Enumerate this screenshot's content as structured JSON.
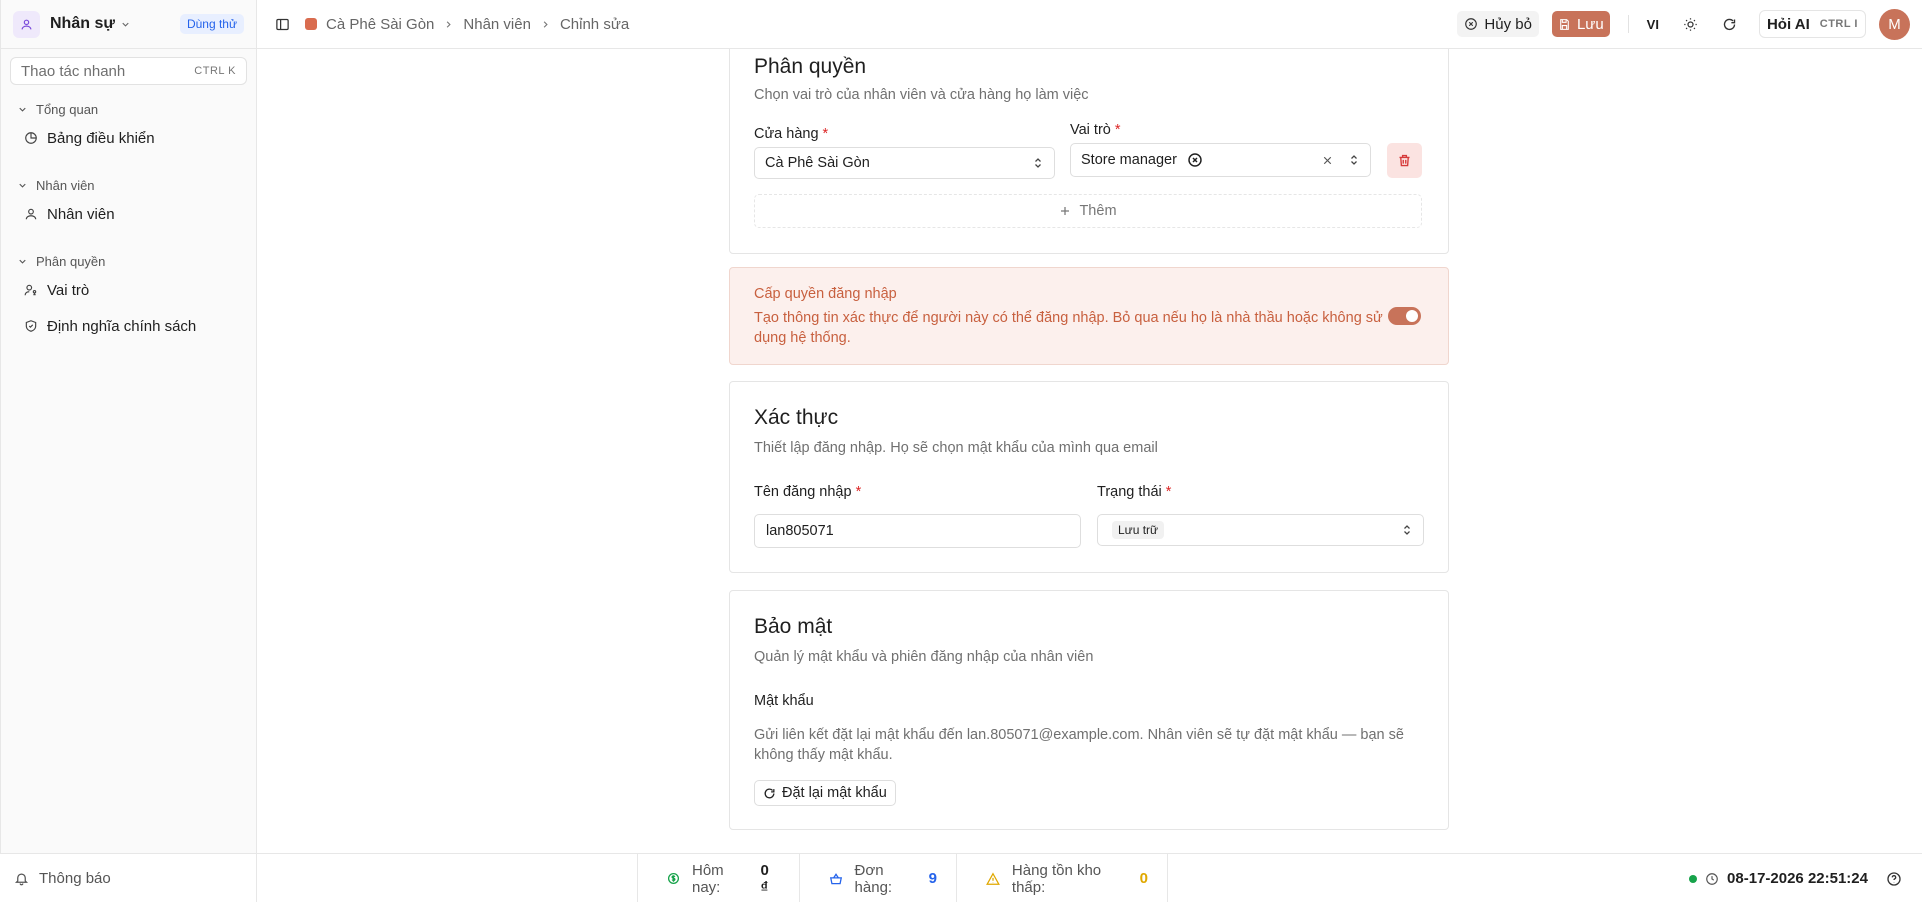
{
  "app": {
    "name": "Nhân sự",
    "trial_badge": "Dùng thử",
    "quick_action_placeholder": "Thao tác nhanh",
    "quick_action_shortcut": "CTRL K"
  },
  "sidebar": {
    "groups": [
      {
        "label": "Tổng quan",
        "items": [
          {
            "label": "Bảng điều khiển",
            "icon": "dashboard-icon"
          }
        ]
      },
      {
        "label": "Nhân viên",
        "items": [
          {
            "label": "Nhân viên",
            "icon": "user-icon"
          }
        ]
      },
      {
        "label": "Phân quyền",
        "items": [
          {
            "label": "Vai trò",
            "icon": "users-key-icon"
          },
          {
            "label": "Định nghĩa chính sách",
            "icon": "shield-icon"
          }
        ]
      }
    ]
  },
  "breadcrumb": [
    "Cà Phê Sài Gòn",
    "Nhân viên",
    "Chỉnh sửa"
  ],
  "toolbar": {
    "cancel_label": "Hủy bỏ",
    "save_label": "Lưu",
    "language": "VI",
    "ask_ai_label": "Hỏi AI",
    "ask_ai_shortcut": "CTRL I",
    "user_initial": "M"
  },
  "permissions": {
    "title": "Phân quyền",
    "description": "Chọn vai trò của nhân viên và cửa hàng họ làm việc",
    "store_label": "Cửa hàng",
    "store_value": "Cà Phê Sài Gòn",
    "role_label": "Vai trò",
    "role_value": "Store manager",
    "add_label": "Thêm"
  },
  "login_grant": {
    "title": "Cấp quyền đăng nhập",
    "description": "Tạo thông tin xác thực để người này có thể đăng nhập. Bỏ qua nếu họ là nhà thầu hoặc không sử dụng hệ thống.",
    "enabled": true
  },
  "auth": {
    "title": "Xác thực",
    "description": "Thiết lập đăng nhập. Họ sẽ chọn mật khẩu của mình qua email",
    "username_label": "Tên đăng nhập",
    "username_value": "lan805071",
    "status_label": "Trạng thái",
    "status_value": "Lưu trữ"
  },
  "security": {
    "title": "Bảo mật",
    "description": "Quản lý mật khẩu và phiên đăng nhập của nhân viên",
    "password_label": "Mật khẩu",
    "password_note": "Gửi liên kết đặt lại mật khẩu đến lan.805071@example.com. Nhân viên sẽ tự đặt mật khẩu — bạn sẽ không thấy mật khẩu.",
    "reset_label": "Đặt lại mật khẩu"
  },
  "footer": {
    "notifications_label": "Thông báo",
    "today_label": "Hôm nay:",
    "today_value": "0 ₫",
    "orders_label": "Đơn hàng:",
    "orders_value": "9",
    "low_stock_label": "Hàng tồn kho thấp:",
    "low_stock_value": "0",
    "datetime": "08-17-2026 22:51:24"
  },
  "colors": {
    "accent": "#c8735a",
    "trial_blue": "#2563eb",
    "orders_blue": "#2563eb",
    "low_stock_amber": "#e0a800",
    "online_green": "#16a34a"
  }
}
